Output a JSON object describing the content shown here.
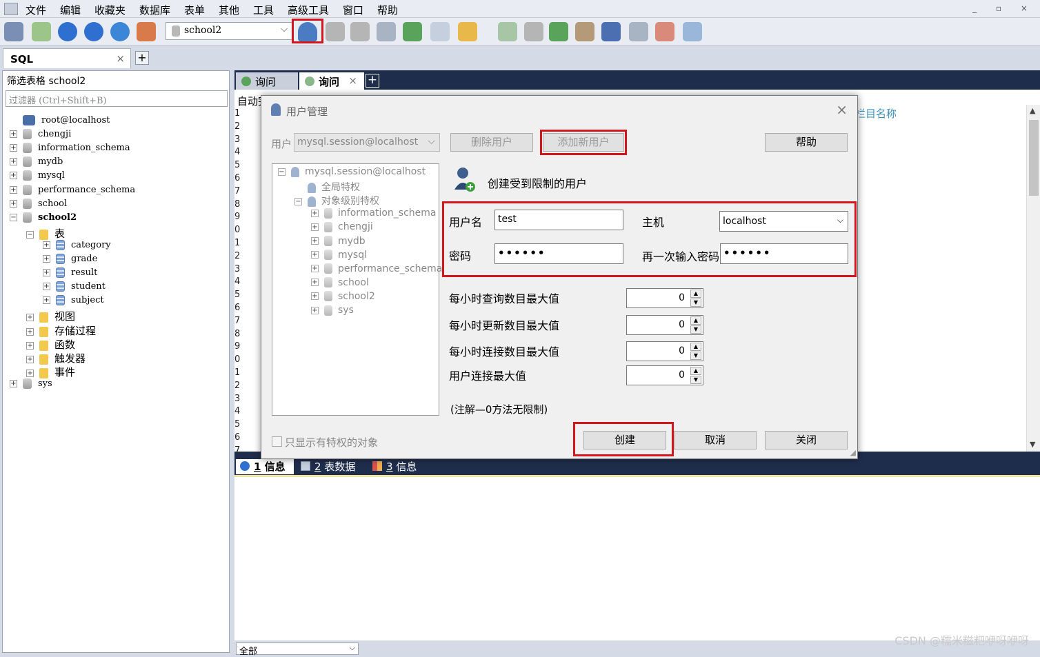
{
  "menu": [
    "文件",
    "编辑",
    "收藏夹",
    "数据库",
    "表单",
    "其他",
    "工具",
    "高级工具",
    "窗口",
    "帮助"
  ],
  "window_controls": "_ ▫ ×",
  "toolbar": {
    "db_select": "school2"
  },
  "sql_tab": {
    "label": "SQL",
    "close": "×",
    "add": "+"
  },
  "left": {
    "filter_label": "筛选表格 school2",
    "filter_placeholder": "过滤器 (Ctrl+Shift+B)",
    "tree": [
      {
        "label": "root@localhost",
        "level": 0,
        "icon": "host",
        "exp": ""
      },
      {
        "label": "chengji",
        "level": 0,
        "icon": "db",
        "exp": "+"
      },
      {
        "label": "information_schema",
        "level": 0,
        "icon": "db",
        "exp": "+"
      },
      {
        "label": "mydb",
        "level": 0,
        "icon": "db",
        "exp": "+"
      },
      {
        "label": "mysql",
        "level": 0,
        "icon": "db",
        "exp": "+"
      },
      {
        "label": "performance_schema",
        "level": 0,
        "icon": "db",
        "exp": "+"
      },
      {
        "label": "school",
        "level": 0,
        "icon": "db",
        "exp": "+"
      },
      {
        "label": "school2",
        "level": 0,
        "icon": "db",
        "exp": "−",
        "bold": true
      },
      {
        "label": "表",
        "level": 1,
        "icon": "folder",
        "exp": "−",
        "cjk": true
      },
      {
        "label": "category",
        "level": 2,
        "icon": "table",
        "exp": "+"
      },
      {
        "label": "grade",
        "level": 2,
        "icon": "table",
        "exp": "+"
      },
      {
        "label": "result",
        "level": 2,
        "icon": "table",
        "exp": "+"
      },
      {
        "label": "student",
        "level": 2,
        "icon": "table",
        "exp": "+"
      },
      {
        "label": "subject",
        "level": 2,
        "icon": "table",
        "exp": "+"
      },
      {
        "label": "视图",
        "level": 1,
        "icon": "folder",
        "exp": "+",
        "cjk": true
      },
      {
        "label": "存储过程",
        "level": 1,
        "icon": "folder",
        "exp": "+",
        "cjk": true
      },
      {
        "label": "函数",
        "level": 1,
        "icon": "folder",
        "exp": "+",
        "cjk": true
      },
      {
        "label": "触发器",
        "level": 1,
        "icon": "folder",
        "exp": "+",
        "cjk": true
      },
      {
        "label": "事件",
        "level": 1,
        "icon": "folder",
        "exp": "+",
        "cjk": true
      },
      {
        "label": "sys",
        "level": 0,
        "icon": "db",
        "exp": "+"
      }
    ]
  },
  "editor": {
    "tabs": [
      "询问",
      "询问"
    ],
    "tab_close": "×",
    "tab_add": "+",
    "auto_complete": "自动完成",
    "column_header": "栏目名称",
    "line_numbers": [
      "1",
      "2",
      "3",
      "4",
      "5",
      "6",
      "7",
      "8",
      "9",
      "0",
      "1",
      "2",
      "3",
      "4",
      "5",
      "6",
      "7",
      "8",
      "9",
      "0",
      "1",
      "2",
      "3",
      "4",
      "5",
      "6",
      "7"
    ]
  },
  "results": {
    "tabs": [
      {
        "num": "1",
        "label": "信息"
      },
      {
        "num": "2",
        "label": "表数据"
      },
      {
        "num": "3",
        "label": "信息"
      }
    ],
    "filter_select": "全部"
  },
  "dialog": {
    "title": "用户管理",
    "close": "×",
    "user_label": "用户",
    "user_select": "mysql.session@localhost",
    "delete_button": "删除用户",
    "add_button": "添加新用户",
    "help_button": "帮助",
    "header_text": "创建受到限制的用户",
    "tree": [
      {
        "label": "mysql.session@localhost",
        "level": 0,
        "exp": "−",
        "icon": "user"
      },
      {
        "label": "全局特权",
        "level": 1,
        "exp": "",
        "icon": "user"
      },
      {
        "label": "对象级别特权",
        "level": 1,
        "exp": "−",
        "icon": "user"
      },
      {
        "label": "information_schema",
        "level": 2,
        "exp": "+",
        "icon": "db"
      },
      {
        "label": "chengji",
        "level": 2,
        "exp": "+",
        "icon": "db"
      },
      {
        "label": "mydb",
        "level": 2,
        "exp": "+",
        "icon": "db"
      },
      {
        "label": "mysql",
        "level": 2,
        "exp": "+",
        "icon": "db"
      },
      {
        "label": "performance_schema",
        "level": 2,
        "exp": "+",
        "icon": "db"
      },
      {
        "label": "school",
        "level": 2,
        "exp": "+",
        "icon": "db"
      },
      {
        "label": "school2",
        "level": 2,
        "exp": "+",
        "icon": "db"
      },
      {
        "label": "sys",
        "level": 2,
        "exp": "+",
        "icon": "db"
      }
    ],
    "username_label": "用户名",
    "username_value": "test",
    "host_label": "主机",
    "host_value": "localhost",
    "password_label": "密码",
    "password_value": "••••••",
    "password_confirm_label": "再一次输入密码",
    "password_confirm_value": "••••••",
    "limits": [
      {
        "label": "每小时查询数目最大值",
        "value": "0"
      },
      {
        "label": "每小时更新数目最大值",
        "value": "0"
      },
      {
        "label": "每小时连接数目最大值",
        "value": "0"
      },
      {
        "label": "用户连接最大值",
        "value": "0"
      }
    ],
    "note": "(注解—0方法无限制)",
    "checkbox_label": "只显示有特权的对象",
    "create_button": "创建",
    "cancel_button": "取消",
    "close_button": "关闭"
  },
  "watermark": "CSDN @糯米糍粑咿呀咿呀",
  "colors": {
    "highlight": "#d4161c",
    "tab_bar": "#1f2d4c",
    "accent_text": "#3a8fb7"
  }
}
